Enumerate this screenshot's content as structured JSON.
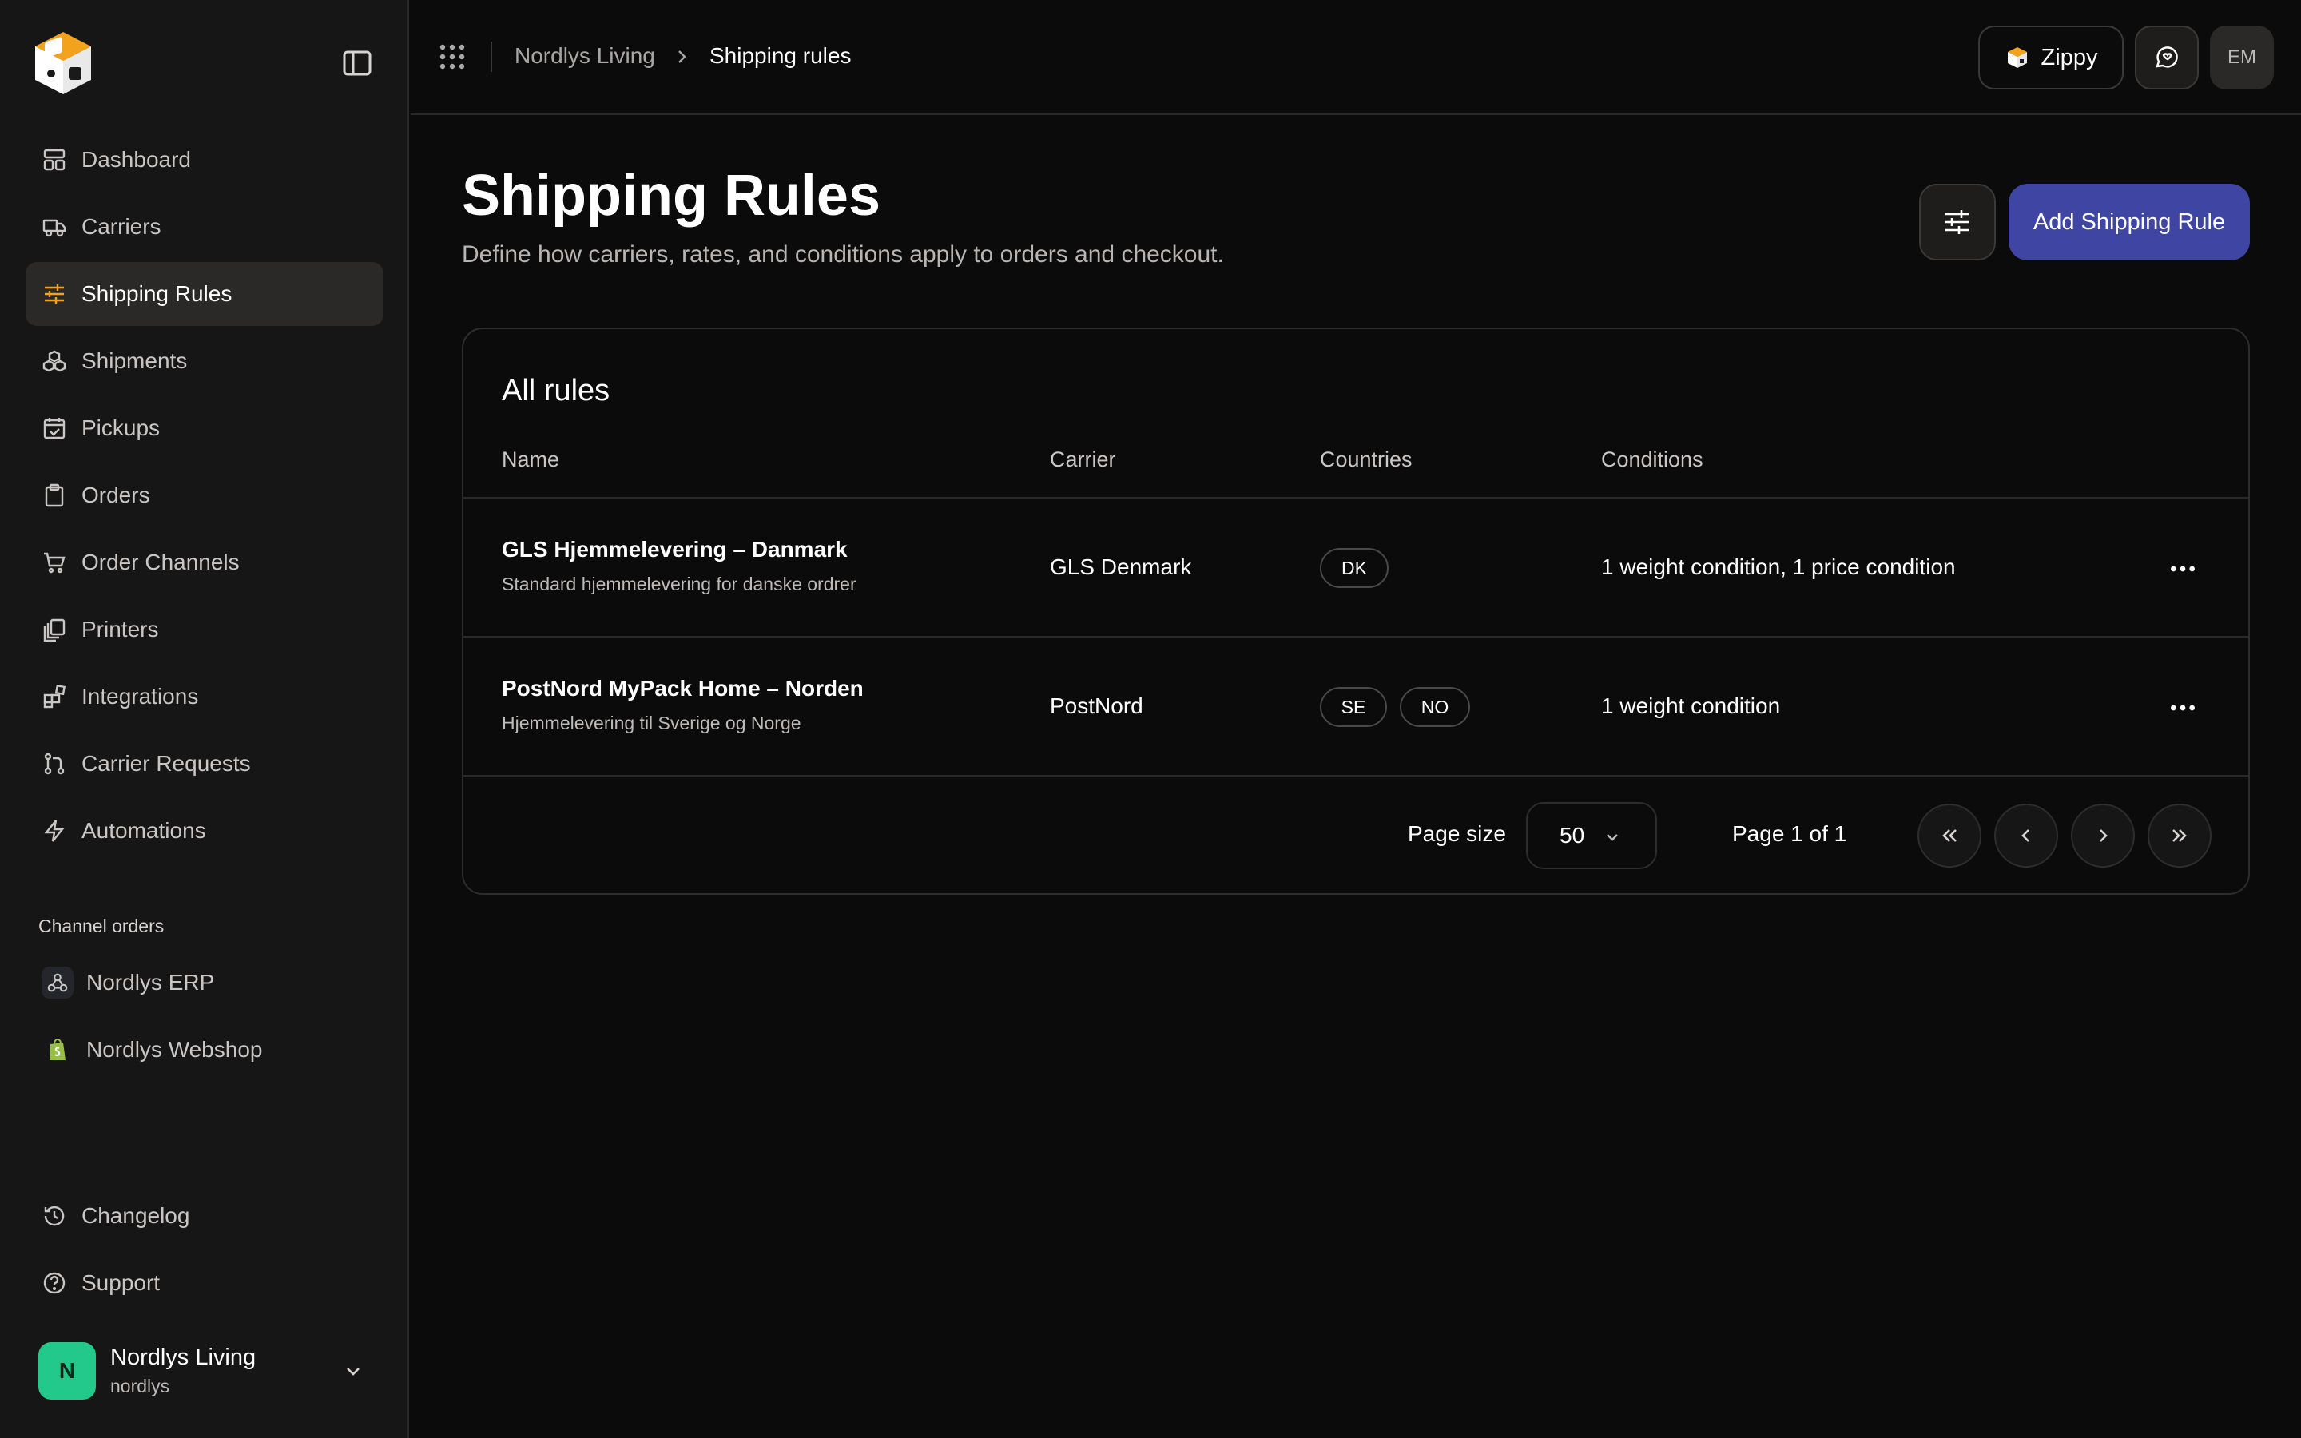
{
  "app": {
    "logo_icon": "cube-logo-icon",
    "brand_color": "#f2a21c",
    "accent_color": "#3f45a3"
  },
  "sidebar": {
    "items": [
      {
        "label": "Dashboard",
        "icon": "dashboard-icon"
      },
      {
        "label": "Carriers",
        "icon": "truck-icon"
      },
      {
        "label": "Shipping Rules",
        "icon": "sliders-icon",
        "active": true
      },
      {
        "label": "Shipments",
        "icon": "boxes-icon"
      },
      {
        "label": "Pickups",
        "icon": "calendar-check-icon"
      },
      {
        "label": "Orders",
        "icon": "clipboard-icon"
      },
      {
        "label": "Order Channels",
        "icon": "cart-icon"
      },
      {
        "label": "Printers",
        "icon": "printer-icon"
      },
      {
        "label": "Integrations",
        "icon": "blocks-icon"
      },
      {
        "label": "Carrier Requests",
        "icon": "git-pull-icon"
      },
      {
        "label": "Automations",
        "icon": "bolt-icon"
      }
    ],
    "channel_section_label": "Channel orders",
    "channels": [
      {
        "label": "Nordlys ERP",
        "icon": "webhook-icon"
      },
      {
        "label": "Nordlys Webshop",
        "icon": "shopify-bag-icon"
      }
    ],
    "bottom_items": [
      {
        "label": "Changelog",
        "icon": "history-icon"
      },
      {
        "label": "Support",
        "icon": "help-circle-icon"
      }
    ],
    "account": {
      "initial": "N",
      "name": "Nordlys Living",
      "slug": "nordlys",
      "color": "#22c98a"
    }
  },
  "topbar": {
    "breadcrumb": [
      "Nordlys Living",
      "Shipping rules"
    ],
    "zippy_label": "Zippy",
    "user_initials": "EM"
  },
  "page": {
    "title": "Shipping Rules",
    "subtitle": "Define how carriers, rates, and conditions apply to orders and checkout.",
    "add_button": "Add Shipping Rule"
  },
  "table": {
    "title": "All rules",
    "columns": [
      "Name",
      "Carrier",
      "Countries",
      "Conditions"
    ],
    "rows": [
      {
        "name": "GLS Hjemmelevering – Danmark",
        "description": "Standard hjemmelevering for danske ordrer",
        "carrier": "GLS Denmark",
        "countries": [
          "DK"
        ],
        "conditions": "1 weight condition, 1 price condition"
      },
      {
        "name": "PostNord MyPack Home – Norden",
        "description": "Hjemmelevering til Sverige og Norge",
        "carrier": "PostNord",
        "countries": [
          "SE",
          "NO"
        ],
        "conditions": "1 weight condition"
      }
    ]
  },
  "pagination": {
    "page_size_label": "Page size",
    "page_size": "50",
    "page_text": "Page 1 of 1"
  }
}
